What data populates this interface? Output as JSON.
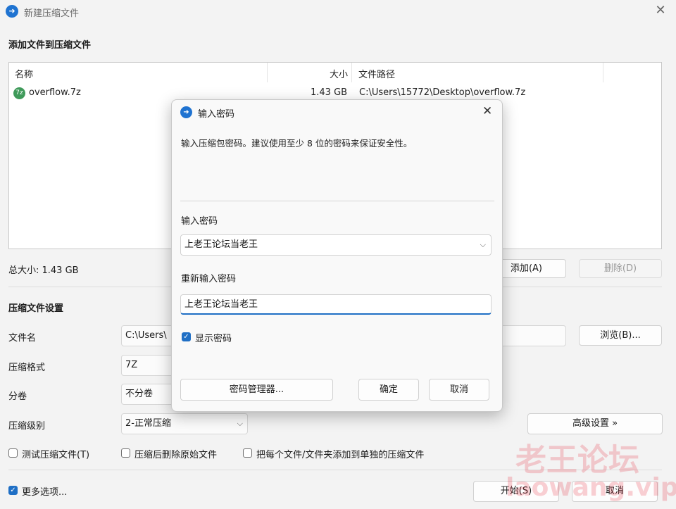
{
  "window": {
    "title": "新建压缩文件",
    "close_glyph": "✕"
  },
  "add_section": {
    "heading": "添加文件到压缩文件"
  },
  "file_list": {
    "columns": {
      "name": "名称",
      "size": "大小",
      "path": "文件路径"
    },
    "rows": [
      {
        "name": "overflow.7z",
        "size": "1.43 GB",
        "path": "C:\\Users\\15772\\Desktop\\overflow.7z",
        "icon": "archive-file-icon"
      }
    ]
  },
  "total_size": "总大小: 1.43 GB",
  "buttons": {
    "add": "添加(A)",
    "remove": "删除(D)",
    "browse": "浏览(B)...",
    "advanced": "高级设置 »",
    "start": "开始(S)",
    "cancel": "取消"
  },
  "settings": {
    "heading": "压缩文件设置",
    "filename_label": "文件名",
    "filename_value": "C:\\Users\\",
    "format_label": "压缩格式",
    "format_value": "7Z",
    "split_label": "分卷",
    "split_value": "不分卷",
    "level_label": "压缩级别",
    "level_value": "2-正常压缩"
  },
  "options": {
    "test": "测试压缩文件(T)",
    "delete_after": "压缩后删除原始文件",
    "separate": "把每个文件/文件夹添加到单独的压缩文件",
    "more": "更多选项..."
  },
  "dialog": {
    "title": "输入密码",
    "hint": "输入压缩包密码。建议使用至少 8 位的密码来保证安全性。",
    "password_label": "输入密码",
    "password_value": "上老王论坛当老王",
    "confirm_label": "重新输入密码",
    "confirm_value": "上老王论坛当老王",
    "show_password": "显示密码",
    "manager_button": "密码管理器...",
    "ok_button": "确定",
    "cancel_button": "取消"
  },
  "watermark": {
    "line1": "老王论坛",
    "line2": "laowang.vip"
  },
  "colors": {
    "accent": "#1f6fc5",
    "watermark": "#e6283c"
  }
}
